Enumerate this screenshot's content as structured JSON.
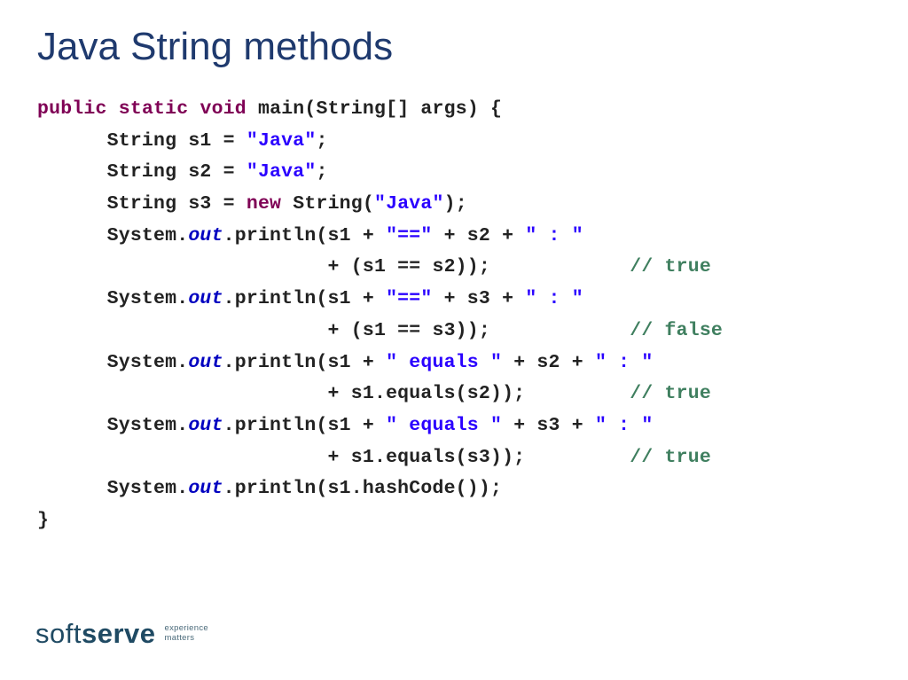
{
  "title": "Java String methods",
  "code": {
    "l01a": "public",
    "l01b": " ",
    "l01c": "static",
    "l01d": " ",
    "l01e": "void",
    "l01f": " main(String[] args) {",
    "l02a": "      String s1 = ",
    "l02b": "\"Java\"",
    "l02c": ";",
    "l03a": "      String s2 = ",
    "l03b": "\"Java\"",
    "l03c": ";",
    "l04a": "      String s3 = ",
    "l04b": "new",
    "l04c": " String(",
    "l04d": "\"Java\"",
    "l04e": ");",
    "l05a": "      System.",
    "l05b": "out",
    "l05c": ".println(s1 + ",
    "l05d": "\"==\"",
    "l05e": " + s2 + ",
    "l05f": "\" : \"",
    "l06a": "                         + (s1 == s2));            ",
    "l06b": "// true",
    "l07a": "      System.",
    "l07b": "out",
    "l07c": ".println(s1 + ",
    "l07d": "\"==\"",
    "l07e": " + s3 + ",
    "l07f": "\" : \"",
    "l08a": "                         + (s1 == s3));            ",
    "l08b": "// false",
    "l09a": "      System.",
    "l09b": "out",
    "l09c": ".println(s1 + ",
    "l09d": "\" equals \"",
    "l09e": " + s2 + ",
    "l09f": "\" : \"",
    "l10a": "                         + s1.equals(s2));         ",
    "l10b": "// true",
    "l11a": "      System.",
    "l11b": "out",
    "l11c": ".println(s1 + ",
    "l11d": "\" equals \"",
    "l11e": " + s3 + ",
    "l11f": "\" : \"",
    "l12a": "                         + s1.equals(s3));         ",
    "l12b": "// true",
    "l13a": "      System.",
    "l13b": "out",
    "l13c": ".println(s1.hashCode());",
    "l14a": "}"
  },
  "logo": {
    "soft": "soft",
    "serve": "serve",
    "tag1": "experience",
    "tag2": "matters"
  }
}
